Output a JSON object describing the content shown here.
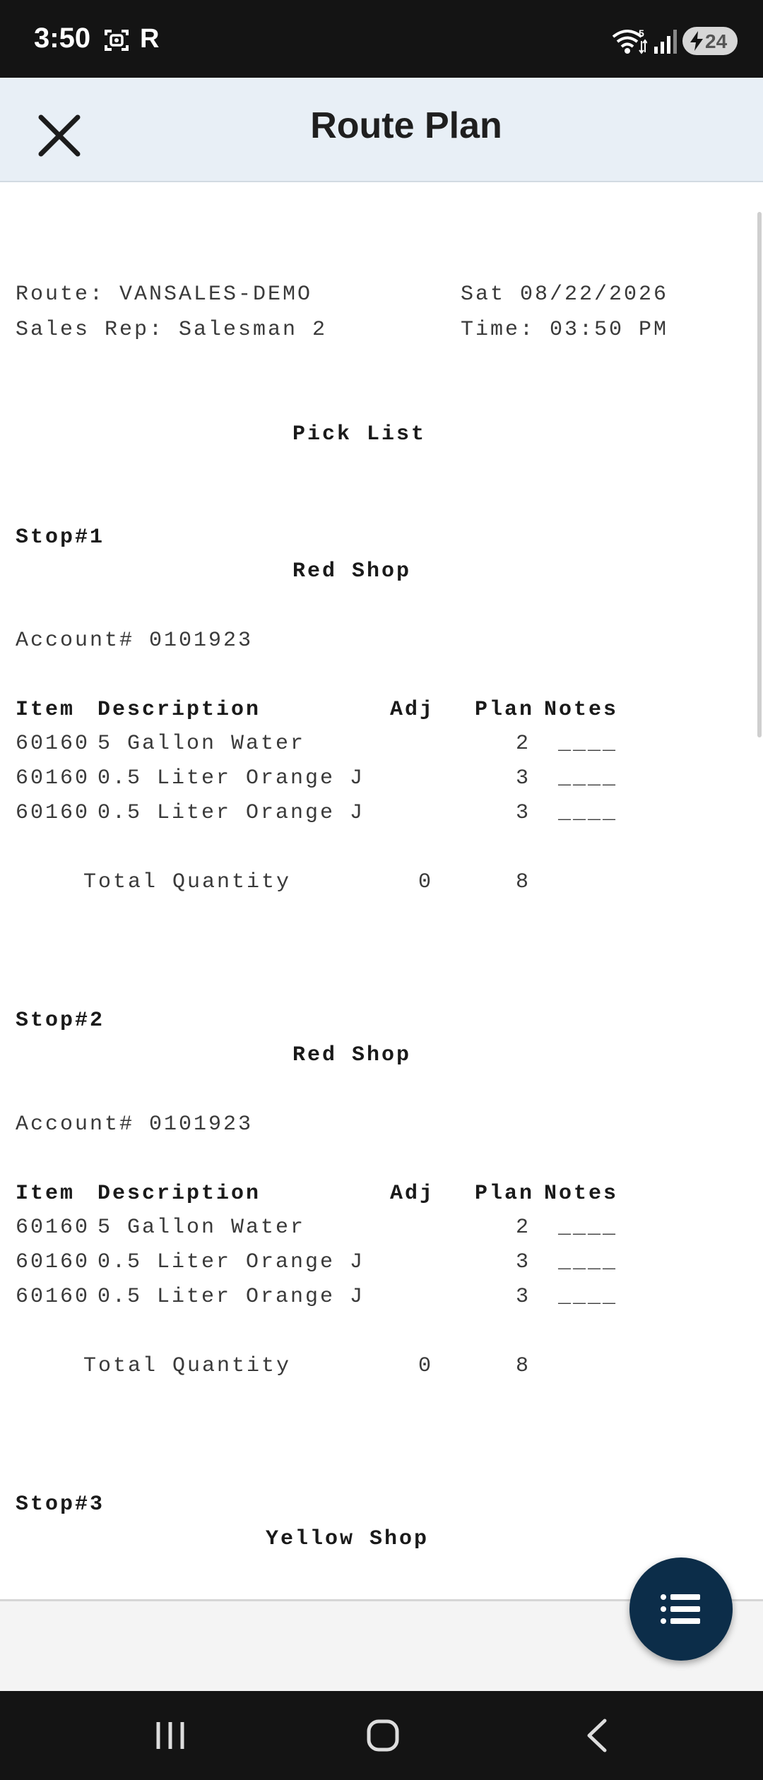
{
  "status_bar": {
    "time": "3:50",
    "r_label": "R",
    "battery": "24"
  },
  "app_bar": {
    "title": "Route Plan"
  },
  "report": {
    "route_line": "Route: VANSALES-DEMO",
    "date_line": "Sat 08/22/2026",
    "rep_line": "Sales Rep: Salesman 2",
    "time_line": "Time: 03:50 PM",
    "heading": "Pick List",
    "headers": {
      "item": "Item",
      "description": "Description",
      "adj": "Adj",
      "plan": "Plan",
      "notes": "Notes"
    },
    "total_label": "Total Quantity",
    "stops": [
      {
        "stop": "Stop#1",
        "shop": "Red Shop",
        "account": "Account# 0101923",
        "rows": [
          {
            "item": "60160",
            "description": "5 Gallon Water",
            "plan": "2",
            "notes": "____"
          },
          {
            "item": "60160",
            "description": "0.5 Liter Orange J",
            "plan": "3",
            "notes": "____"
          },
          {
            "item": "60160",
            "description": "0.5 Liter Orange J",
            "plan": "3",
            "notes": "____"
          }
        ],
        "total_adj": "0",
        "total_plan": "8"
      },
      {
        "stop": "Stop#2",
        "shop": "Red Shop",
        "account": "Account# 0101923",
        "rows": [
          {
            "item": "60160",
            "description": "5 Gallon Water",
            "plan": "2",
            "notes": "____"
          },
          {
            "item": "60160",
            "description": "0.5 Liter Orange J",
            "plan": "3",
            "notes": "____"
          },
          {
            "item": "60160",
            "description": "0.5 Liter Orange J",
            "plan": "3",
            "notes": "____"
          }
        ],
        "total_adj": "0",
        "total_plan": "8"
      },
      {
        "stop": "Stop#3",
        "shop": "Yellow Shop"
      }
    ]
  }
}
